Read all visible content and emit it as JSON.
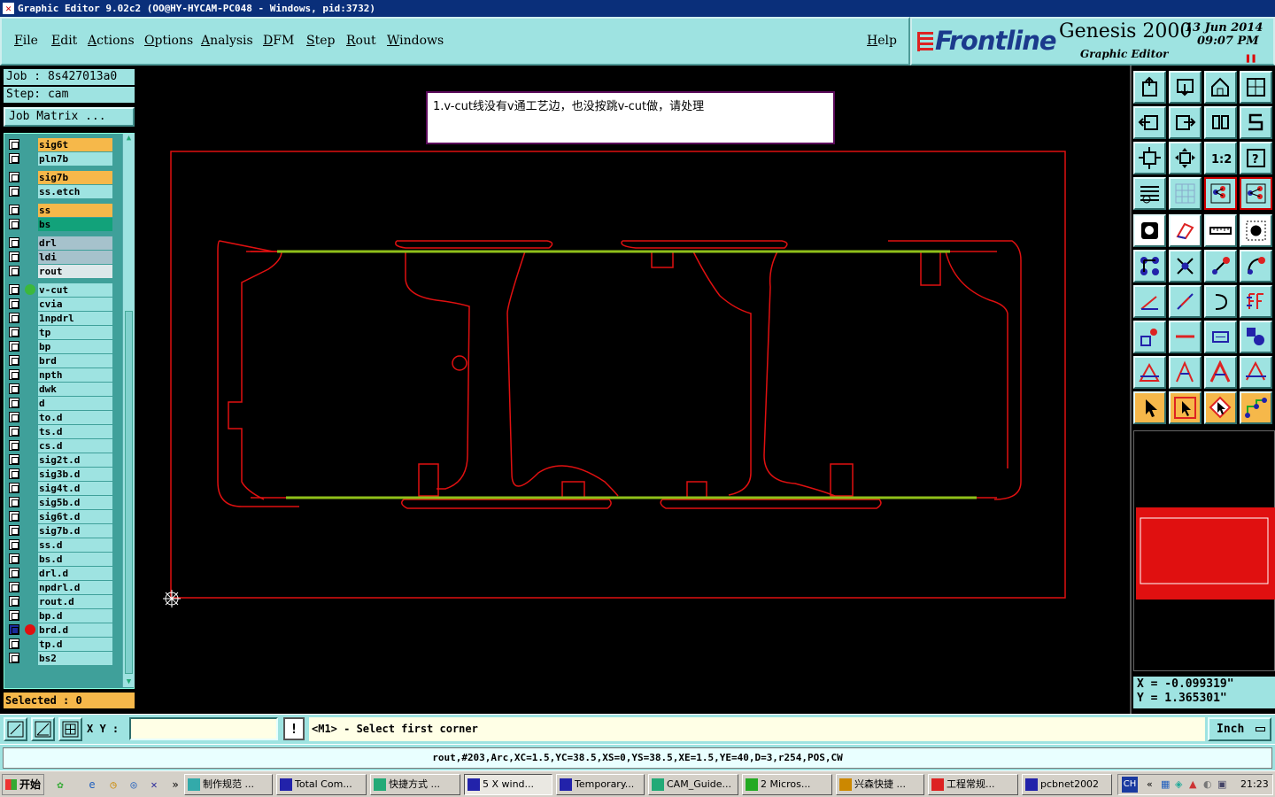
{
  "window": {
    "title": "Graphic Editor 9.02c2  (OO@HY-HYCAM-PC048 - Windows, pid:3732)"
  },
  "menu": [
    "File",
    "Edit",
    "Actions",
    "Options",
    "Analysis",
    "DFM",
    "Step",
    "Rout",
    "Windows"
  ],
  "help_label": "Help",
  "brand": {
    "name": "Frontline",
    "product": "Genesis 2000",
    "subtitle": "Graphic Editor",
    "date": "13  Jun  2014",
    "time": "09:07  PM"
  },
  "job": {
    "job_label": "Job : 8s427013a0",
    "step_label": "Step: cam",
    "matrix_button": "Job Matrix ..."
  },
  "layers": [
    {
      "name": "sig6t",
      "color": "#f6b84a",
      "dot": ""
    },
    {
      "name": "pln7b",
      "color": "#9ee3e1",
      "dot": ""
    },
    {
      "name": "sig7b",
      "color": "#f6b84a",
      "dot": ""
    },
    {
      "name": "ss.etch",
      "color": "#9ee3e1",
      "dot": ""
    },
    {
      "name": "ss",
      "color": "#f6b84a",
      "dot": ""
    },
    {
      "name": "bs",
      "color": "#12a27a",
      "dot": ""
    },
    {
      "name": "drl",
      "color": "#a6c2cc",
      "dot": ""
    },
    {
      "name": "ldi",
      "color": "#a6c2cc",
      "dot": ""
    },
    {
      "name": "rout",
      "color": "#dde8ea",
      "dot": ""
    },
    {
      "name": "v-cut",
      "color": "#9ee3e1",
      "dot": "#3cb83c"
    },
    {
      "name": "cvia",
      "color": "#9ee3e1",
      "dot": ""
    },
    {
      "name": "1npdrl",
      "color": "#9ee3e1",
      "dot": ""
    },
    {
      "name": "tp",
      "color": "#9ee3e1",
      "dot": ""
    },
    {
      "name": "bp",
      "color": "#9ee3e1",
      "dot": ""
    },
    {
      "name": "brd",
      "color": "#9ee3e1",
      "dot": ""
    },
    {
      "name": "npth",
      "color": "#9ee3e1",
      "dot": ""
    },
    {
      "name": "dwk",
      "color": "#9ee3e1",
      "dot": ""
    },
    {
      "name": "d",
      "color": "#9ee3e1",
      "dot": ""
    },
    {
      "name": "to.d",
      "color": "#9ee3e1",
      "dot": ""
    },
    {
      "name": "ts.d",
      "color": "#9ee3e1",
      "dot": ""
    },
    {
      "name": "cs.d",
      "color": "#9ee3e1",
      "dot": ""
    },
    {
      "name": "sig2t.d",
      "color": "#9ee3e1",
      "dot": ""
    },
    {
      "name": "sig3b.d",
      "color": "#9ee3e1",
      "dot": ""
    },
    {
      "name": "sig4t.d",
      "color": "#9ee3e1",
      "dot": ""
    },
    {
      "name": "sig5b.d",
      "color": "#9ee3e1",
      "dot": ""
    },
    {
      "name": "sig6t.d",
      "color": "#9ee3e1",
      "dot": ""
    },
    {
      "name": "sig7b.d",
      "color": "#9ee3e1",
      "dot": ""
    },
    {
      "name": "ss.d",
      "color": "#9ee3e1",
      "dot": ""
    },
    {
      "name": "bs.d",
      "color": "#9ee3e1",
      "dot": ""
    },
    {
      "name": "drl.d",
      "color": "#9ee3e1",
      "dot": ""
    },
    {
      "name": "npdrl.d",
      "color": "#9ee3e1",
      "dot": ""
    },
    {
      "name": "rout.d",
      "color": "#9ee3e1",
      "dot": ""
    },
    {
      "name": "bp.d",
      "color": "#9ee3e1",
      "dot": ""
    },
    {
      "name": "brd.d",
      "color": "#9ee3e1",
      "dot": "#e01010"
    },
    {
      "name": "tp.d",
      "color": "#9ee3e1",
      "dot": ""
    },
    {
      "name": "bs2",
      "color": "#9ee3e1",
      "dot": ""
    }
  ],
  "selected_text": "Selected : 0",
  "note": "1.v-cut线没有v通工艺边，也没按跳v-cut做，请处理",
  "coords": {
    "x": "X = -0.099319\"",
    "y": "Y =  1.365301\""
  },
  "xy_label": "X Y :",
  "xy_value": "",
  "prompt": "<M1> - Select first corner",
  "unit": "Inch",
  "status": "rout,#203,Arc,XC=1.5,YC=38.5,XS=0,YS=38.5,XE=1.5,YE=40,D=3,r254,POS,CW",
  "taskbar": {
    "start": "开始",
    "buttons": [
      "制作规范 ...",
      "Total Com...",
      "快捷方式 ...",
      "5 X wind...",
      "Temporary...",
      "CAM_Guide...",
      "2 Micros...",
      "兴森快捷 ...",
      "工程常规...",
      "pcbnet2002"
    ],
    "tray_lang": "CH",
    "clock": "21:23"
  }
}
